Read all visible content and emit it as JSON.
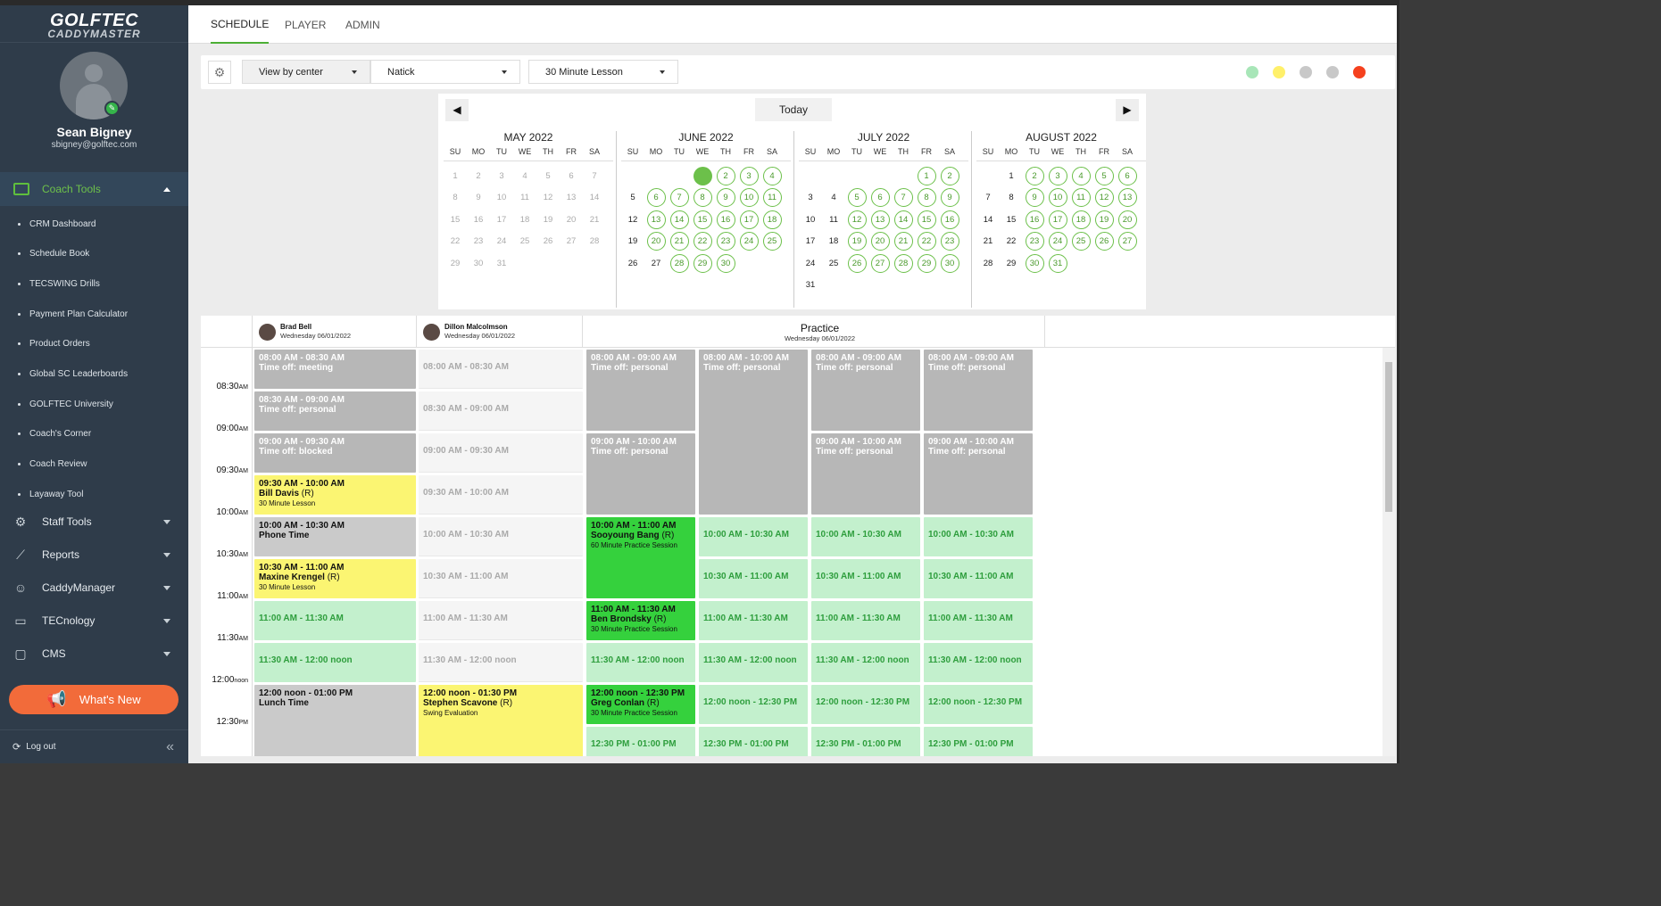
{
  "sidebar": {
    "logo_line1": "GOLFTEC",
    "logo_line2": "CADDYMASTER",
    "user_name": "Sean Bigney",
    "user_email": "sbigney@golftec.com",
    "coach_tools_label": "Coach Tools",
    "coach_items": [
      "CRM Dashboard",
      "Schedule Book",
      "TECSWING Drills",
      "Payment Plan Calculator",
      "Product Orders",
      "Global SC Leaderboards",
      "GOLFTEC University",
      "Coach's Corner",
      "Coach Review",
      "Layaway Tool"
    ],
    "sections": [
      {
        "label": "Staff Tools",
        "icon": "gear-group-icon"
      },
      {
        "label": "Reports",
        "icon": "line-chart-icon"
      },
      {
        "label": "CaddyManager",
        "icon": "people-icon"
      },
      {
        "label": "TECnology",
        "icon": "devices-icon"
      },
      {
        "label": "CMS",
        "icon": "monitor-icon"
      }
    ],
    "whats_new": "What's New",
    "logout": "Log out"
  },
  "tabs": [
    "SCHEDULE",
    "PLAYER",
    "ADMIN"
  ],
  "filters": {
    "view": "View by center",
    "center": "Natick",
    "lesson": "30 Minute Lesson"
  },
  "status_colors": [
    "#a8e6b8",
    "#fff06a",
    "#c8c8c8",
    "#c8c8c8",
    "#f5411e"
  ],
  "calendar": {
    "today_label": "Today",
    "dow": [
      "SU",
      "MO",
      "TU",
      "WE",
      "TH",
      "FR",
      "SA"
    ],
    "months": [
      {
        "title": "MAY 2022",
        "offset": 0,
        "days": 31,
        "past_until": 31,
        "avail_from": 99,
        "selected": 0
      },
      {
        "title": "JUNE 2022",
        "offset": 3,
        "days": 30,
        "past_until": 0,
        "avail_from": 2,
        "selected": 1,
        "unavail": [
          5,
          12,
          19,
          26,
          27
        ]
      },
      {
        "title": "JULY 2022",
        "offset": 5,
        "days": 31,
        "past_until": 0,
        "avail_from": 1,
        "selected": 0,
        "unavail": [
          3,
          4,
          10,
          11,
          17,
          18,
          24,
          25,
          31
        ]
      },
      {
        "title": "AUGUST 2022",
        "offset": 1,
        "days": 31,
        "past_until": 0,
        "avail_from": 2,
        "selected": 0,
        "unavail": [
          1,
          7,
          8,
          14,
          15,
          21,
          22,
          28,
          29
        ]
      }
    ]
  },
  "schedule": {
    "columns": [
      {
        "name": "Brad Bell",
        "date": "Wednesday 06/01/2022"
      },
      {
        "name": "Dillon Malcolmson",
        "date": "Wednesday 06/01/2022"
      }
    ],
    "practice_title": "Practice",
    "practice_date": "Wednesday 06/01/2022",
    "times": [
      {
        "t": "08:30",
        "p": "AM"
      },
      {
        "t": "09:00",
        "p": "AM"
      },
      {
        "t": "09:30",
        "p": "AM"
      },
      {
        "t": "10:00",
        "p": "AM"
      },
      {
        "t": "10:30",
        "p": "AM"
      },
      {
        "t": "11:00",
        "p": "AM"
      },
      {
        "t": "11:30",
        "p": "AM"
      },
      {
        "t": "12:00",
        "p": "noon"
      },
      {
        "t": "12:30",
        "p": "PM"
      }
    ],
    "brad": [
      {
        "time": "08:00 AM - 08:30 AM",
        "name": "Time off: meeting",
        "cls": "s-grey",
        "start": 0,
        "len": 1
      },
      {
        "time": "08:30 AM - 09:00 AM",
        "name": "Time off: personal",
        "cls": "s-grey",
        "start": 1,
        "len": 1
      },
      {
        "time": "09:00 AM - 09:30 AM",
        "name": "Time off: blocked",
        "cls": "s-grey",
        "start": 2,
        "len": 1
      },
      {
        "time": "09:30 AM - 10:00 AM",
        "name": "Bill Davis",
        "r": " (R)",
        "type": "30 Minute Lesson",
        "cls": "s-yellow",
        "start": 3,
        "len": 1
      },
      {
        "time": "10:00 AM - 10:30 AM",
        "name": "Phone Time",
        "cls": "s-light",
        "start": 4,
        "len": 1
      },
      {
        "time": "10:30 AM - 11:00 AM",
        "name": "Maxine Krengel",
        "r": " (R)",
        "type": "30 Minute Lesson",
        "cls": "s-yellow",
        "start": 5,
        "len": 1
      },
      {
        "open": "11:00 AM - 11:30 AM",
        "cls": "s-open",
        "start": 6,
        "len": 1
      },
      {
        "open": "11:30 AM - 12:00 noon",
        "cls": "s-open",
        "start": 7,
        "len": 1
      },
      {
        "time": "12:00 noon - 01:00 PM",
        "name": "Lunch Time",
        "cls": "s-light",
        "start": 8,
        "len": 2
      }
    ],
    "dillon": [
      {
        "open": "08:00 AM - 08:30 AM",
        "cls": "s-empty",
        "start": 0,
        "len": 1
      },
      {
        "open": "08:30 AM - 09:00 AM",
        "cls": "s-empty",
        "start": 1,
        "len": 1
      },
      {
        "open": "09:00 AM - 09:30 AM",
        "cls": "s-empty",
        "start": 2,
        "len": 1
      },
      {
        "open": "09:30 AM - 10:00 AM",
        "cls": "s-empty",
        "start": 3,
        "len": 1
      },
      {
        "open": "10:00 AM - 10:30 AM",
        "cls": "s-empty",
        "start": 4,
        "len": 1
      },
      {
        "open": "10:30 AM - 11:00 AM",
        "cls": "s-empty",
        "start": 5,
        "len": 1
      },
      {
        "open": "11:00 AM - 11:30 AM",
        "cls": "s-empty",
        "start": 6,
        "len": 1
      },
      {
        "open": "11:30 AM - 12:00 noon",
        "cls": "s-empty",
        "start": 7,
        "len": 1
      },
      {
        "time": "12:00 noon - 01:30 PM",
        "name": "Stephen Scavone",
        "r": " (R)",
        "type": "Swing Evaluation",
        "cls": "s-yellow",
        "start": 8,
        "len": 2
      }
    ],
    "bay1": [
      {
        "time": "08:00 AM - 09:00 AM",
        "name": "Time off: personal",
        "cls": "s-grey",
        "start": 0,
        "len": 2
      },
      {
        "time": "09:00 AM - 10:00 AM",
        "name": "Time off: personal",
        "cls": "s-grey",
        "start": 2,
        "len": 2
      },
      {
        "time": "10:00 AM - 11:00 AM",
        "name": "Sooyoung Bang",
        "r": " (R)",
        "type": "60 Minute Practice Session",
        "cls": "s-green",
        "start": 4,
        "len": 2
      },
      {
        "time": "11:00 AM - 11:30 AM",
        "name": "Ben Brondsky",
        "r": " (R)",
        "type": "30 Minute Practice Session",
        "cls": "s-green",
        "start": 6,
        "len": 1
      },
      {
        "open": "11:30 AM - 12:00 noon",
        "cls": "s-open",
        "start": 7,
        "len": 1
      },
      {
        "time": "12:00 noon - 12:30 PM",
        "name": "Greg Conlan",
        "r": " (R)",
        "type": "30 Minute Practice Session",
        "cls": "s-green",
        "start": 8,
        "len": 1
      },
      {
        "open": "12:30 PM - 01:00 PM",
        "cls": "s-open",
        "start": 9,
        "len": 1
      }
    ],
    "bay2": [
      {
        "time": "08:00 AM - 10:00 AM",
        "name": "Time off: personal",
        "cls": "s-grey",
        "start": 0,
        "len": 4
      },
      {
        "open": "10:00 AM - 10:30 AM",
        "cls": "s-open",
        "start": 4,
        "len": 1
      },
      {
        "open": "10:30 AM - 11:00 AM",
        "cls": "s-open",
        "start": 5,
        "len": 1
      },
      {
        "open": "11:00 AM - 11:30 AM",
        "cls": "s-open",
        "start": 6,
        "len": 1
      },
      {
        "open": "11:30 AM - 12:00 noon",
        "cls": "s-open",
        "start": 7,
        "len": 1
      },
      {
        "open": "12:00 noon - 12:30 PM",
        "cls": "s-open",
        "start": 8,
        "len": 1
      },
      {
        "open": "12:30 PM - 01:00 PM",
        "cls": "s-open",
        "start": 9,
        "len": 1
      }
    ],
    "bay3": [
      {
        "time": "08:00 AM - 09:00 AM",
        "name": "Time off: personal",
        "cls": "s-grey",
        "start": 0,
        "len": 2
      },
      {
        "time": "09:00 AM - 10:00 AM",
        "name": "Time off: personal",
        "cls": "s-grey",
        "start": 2,
        "len": 2
      },
      {
        "open": "10:00 AM - 10:30 AM",
        "cls": "s-open",
        "start": 4,
        "len": 1
      },
      {
        "open": "10:30 AM - 11:00 AM",
        "cls": "s-open",
        "start": 5,
        "len": 1
      },
      {
        "open": "11:00 AM - 11:30 AM",
        "cls": "s-open",
        "start": 6,
        "len": 1
      },
      {
        "open": "11:30 AM - 12:00 noon",
        "cls": "s-open",
        "start": 7,
        "len": 1
      },
      {
        "open": "12:00 noon - 12:30 PM",
        "cls": "s-open",
        "start": 8,
        "len": 1
      },
      {
        "open": "12:30 PM - 01:00 PM",
        "cls": "s-open",
        "start": 9,
        "len": 1
      }
    ],
    "bay4": [
      {
        "time": "08:00 AM - 09:00 AM",
        "name": "Time off: personal",
        "cls": "s-grey",
        "start": 0,
        "len": 2
      },
      {
        "time": "09:00 AM - 10:00 AM",
        "name": "Time off: personal",
        "cls": "s-grey",
        "start": 2,
        "len": 2
      },
      {
        "open": "10:00 AM - 10:30 AM",
        "cls": "s-open",
        "start": 4,
        "len": 1
      },
      {
        "open": "10:30 AM - 11:00 AM",
        "cls": "s-open",
        "start": 5,
        "len": 1
      },
      {
        "open": "11:00 AM - 11:30 AM",
        "cls": "s-open",
        "start": 6,
        "len": 1
      },
      {
        "open": "11:30 AM - 12:00 noon",
        "cls": "s-open",
        "start": 7,
        "len": 1
      },
      {
        "open": "12:00 noon - 12:30 PM",
        "cls": "s-open",
        "start": 8,
        "len": 1
      },
      {
        "open": "12:30 PM - 01:00 PM",
        "cls": "s-open",
        "start": 9,
        "len": 1
      }
    ]
  }
}
